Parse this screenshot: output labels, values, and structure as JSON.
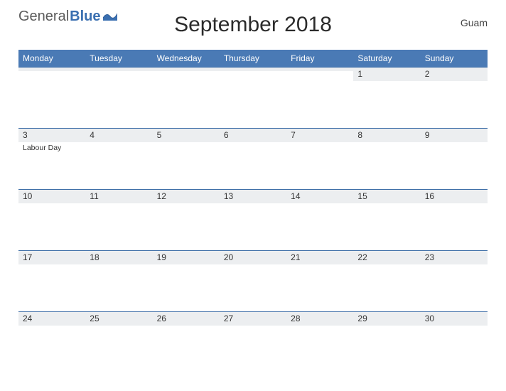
{
  "logo": {
    "part1": "General",
    "part2": "Blue"
  },
  "title": "September 2018",
  "region": "Guam",
  "days": [
    "Monday",
    "Tuesday",
    "Wednesday",
    "Thursday",
    "Friday",
    "Saturday",
    "Sunday"
  ],
  "weeks": [
    [
      {
        "d": ""
      },
      {
        "d": ""
      },
      {
        "d": ""
      },
      {
        "d": ""
      },
      {
        "d": ""
      },
      {
        "d": "1"
      },
      {
        "d": "2"
      }
    ],
    [
      {
        "d": "3",
        "e": "Labour Day"
      },
      {
        "d": "4"
      },
      {
        "d": "5"
      },
      {
        "d": "6"
      },
      {
        "d": "7"
      },
      {
        "d": "8"
      },
      {
        "d": "9"
      }
    ],
    [
      {
        "d": "10"
      },
      {
        "d": "11"
      },
      {
        "d": "12"
      },
      {
        "d": "13"
      },
      {
        "d": "14"
      },
      {
        "d": "15"
      },
      {
        "d": "16"
      }
    ],
    [
      {
        "d": "17"
      },
      {
        "d": "18"
      },
      {
        "d": "19"
      },
      {
        "d": "20"
      },
      {
        "d": "21"
      },
      {
        "d": "22"
      },
      {
        "d": "23"
      }
    ],
    [
      {
        "d": "24"
      },
      {
        "d": "25"
      },
      {
        "d": "26"
      },
      {
        "d": "27"
      },
      {
        "d": "28"
      },
      {
        "d": "29"
      },
      {
        "d": "30"
      }
    ]
  ]
}
